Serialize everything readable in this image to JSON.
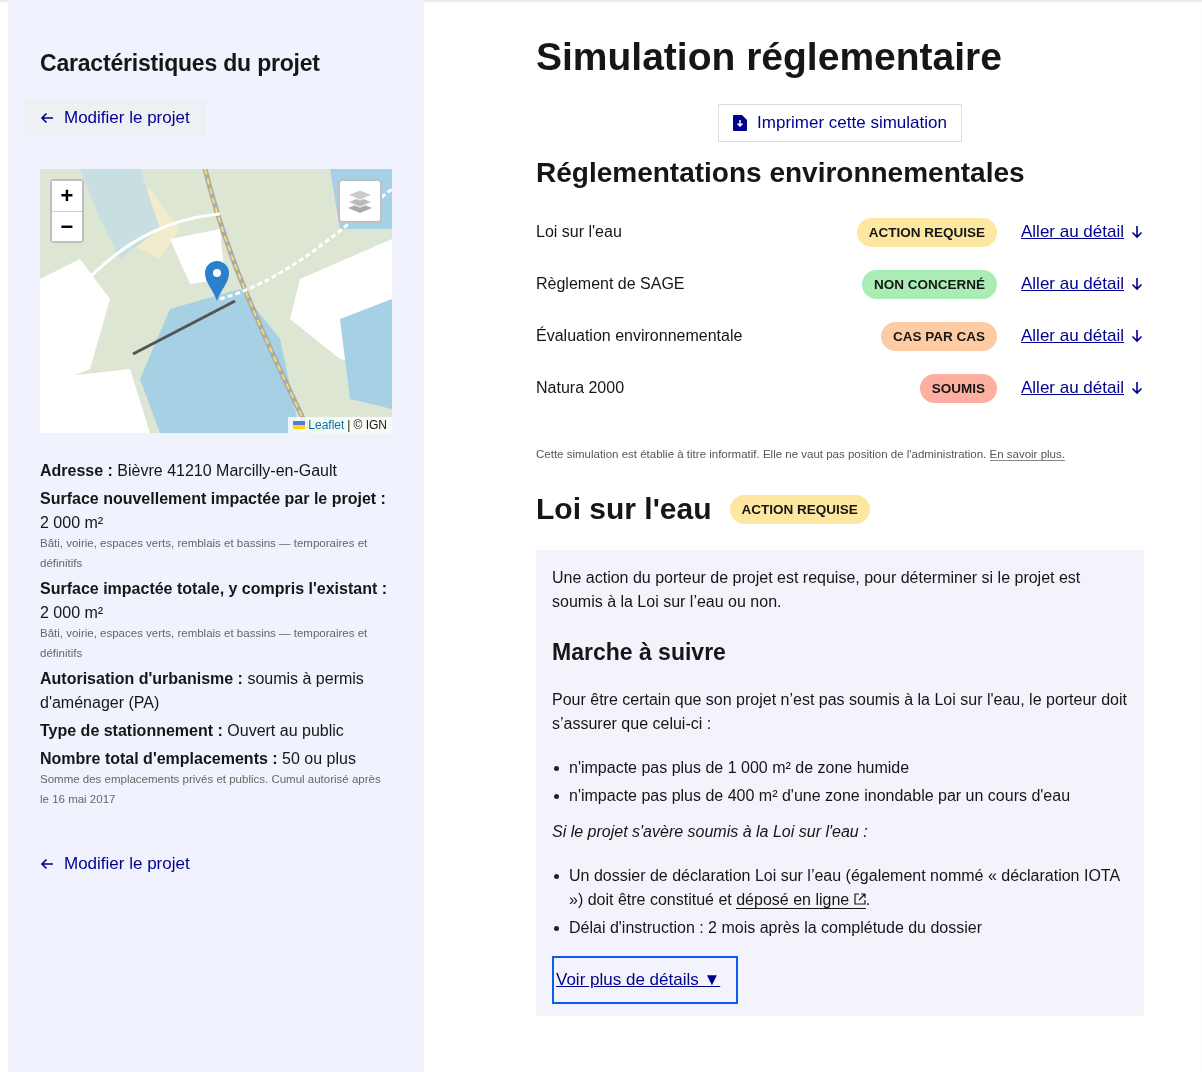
{
  "sidebar": {
    "title": "Caractéristiques du projet",
    "edit_link_top": "Modifier le projet",
    "map": {
      "zoom_in": "+",
      "zoom_out": "−",
      "attribution_leaflet": "Leaflet",
      "attribution_sep": "|",
      "attribution_source": "© IGN"
    },
    "details": [
      {
        "text": "**Adresse :** Bièvre 41210 Marcilly-en-Gault"
      },
      {
        "text": "**Surface nouvellement impactée par le projet :** 2 000 m²",
        "hint": "Bâti, voirie, espaces verts, remblais et bassins — temporaires et définitifs"
      },
      {
        "text": "**Surface impactée totale, y compris l'existant :** 2 000 m²",
        "hint": "Bâti, voirie, espaces verts, remblais et bassins — temporaires et définitifs"
      },
      {
        "text": "**Autorisation d'urbanisme :** soumis à permis d'aménager (PA)"
      },
      {
        "text": "**Type de stationnement :** Ouvert au public"
      },
      {
        "text": "**Nombre total d'emplacements :** 50 ou plus",
        "hint": "Somme des emplacements privés et publics. Cumul autorisé après le 16 mai 2017"
      }
    ],
    "edit_link_bottom": "Modifier le projet"
  },
  "main": {
    "title": "Simulation réglementaire",
    "print_button": "Imprimer cette simulation",
    "regulations_title": "Réglementations environnementales",
    "regulations": [
      {
        "name": "Loi sur l'eau",
        "status": "ACTION REQUISE",
        "color": "#fee7a0",
        "link": "Aller au détail"
      },
      {
        "name": "Règlement de SAGE",
        "status": "NON CONCERNÉ",
        "color": "#a9ecb4",
        "link": "Aller au détail"
      },
      {
        "name": "Évaluation environnementale",
        "status": "CAS PAR CAS",
        "color": "#fecca4",
        "link": "Aller au détail"
      },
      {
        "name": "Natura 2000",
        "status": "SOUMIS",
        "color": "#ffafa1",
        "link": "Aller au détail"
      }
    ],
    "disclaimer": "Cette simulation est établie à titre informatif. Elle ne vaut pas position de l'administration.",
    "disclaimer_link": "En savoir plus.",
    "section": {
      "title": "Loi sur l'eau",
      "status": "ACTION REQUISE",
      "color": "#fee7a0",
      "intro": "Une action du porteur de projet est requise, pour déterminer si le projet est soumis à la Loi sur l’eau ou non.",
      "steps_title": "Marche à suivre",
      "steps_intro": "Pour être certain que son projet n’est pas soumis à la Loi sur l'eau, le porteur doit s’assurer que celui-ci :",
      "conditions": [
        {
          "text": "n'impacte pas plus de 1 000 m² de zone humide"
        },
        {
          "text": "n'impacte pas plus de 400 m² d'une zone inondable par un cours d'eau"
        }
      ],
      "if_subject": "Si le projet s'avère soumis à la Loi sur l'eau :",
      "consequences": [
        {
          "text": "Un dossier de déclaration Loi sur l’eau (également nommé « déclaration IOTA ») doit être constitué et ",
          "link": "déposé en ligne",
          "after": "."
        },
        {
          "text": "Délai d'instruction : 2 mois après la complétude du dossier"
        }
      ],
      "more_link": "Voir plus de détails ▼"
    }
  }
}
